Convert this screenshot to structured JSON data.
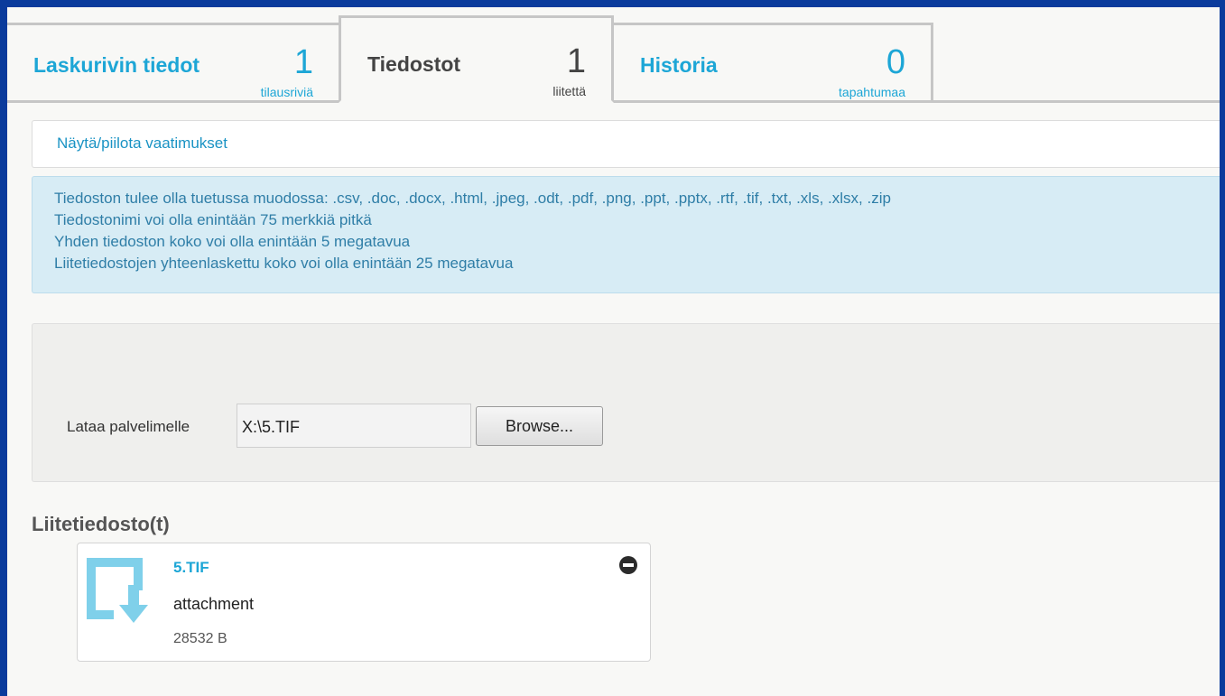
{
  "tabs": [
    {
      "label": "Laskurivin tiedot",
      "count": "1",
      "sub": "tilausriviä",
      "active": false
    },
    {
      "label": "Tiedostot",
      "count": "1",
      "sub": "liitettä",
      "active": true
    },
    {
      "label": "Historia",
      "count": "0",
      "sub": "tapahtumaa",
      "active": false
    }
  ],
  "toggle": {
    "label": "Näytä/piilota vaatimukset"
  },
  "requirements": [
    "Tiedoston tulee olla tuetussa muodossa: .csv, .doc, .docx, .html, .jpeg, .odt, .pdf, .png, .ppt, .pptx, .rtf, .tif, .txt, .xls, .xlsx, .zip",
    "Tiedostonimi voi olla enintään 75 merkkiä pitkä",
    "Yhden tiedoston koko voi olla enintään 5 megatavua",
    "Liitetiedostojen yhteenlaskettu koko voi olla enintään 25 megatavua"
  ],
  "upload": {
    "label": "Lataa palvelimelle",
    "value": "X:\\5.TIF",
    "browse_label": "Browse..."
  },
  "attachments": {
    "heading": "Liitetiedosto(t)",
    "items": [
      {
        "name": "5.TIF",
        "type": "attachment",
        "size": "28532 B",
        "icon": "download-file-icon"
      }
    ]
  },
  "colors": {
    "accent": "#1da6d6",
    "frame": "#0a3b9c",
    "info_bg": "#d7ecf5"
  }
}
